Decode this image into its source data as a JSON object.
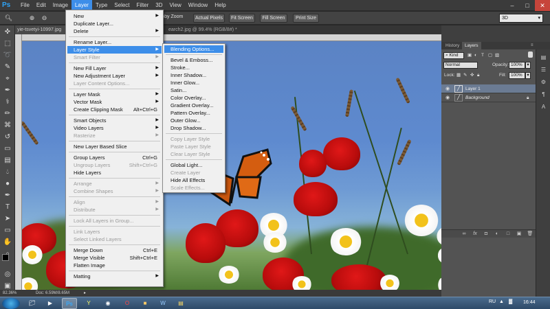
{
  "app": {
    "logo": "Ps",
    "menus": [
      "File",
      "Edit",
      "Image",
      "Layer",
      "Type",
      "Select",
      "Filter",
      "3D",
      "View",
      "Window",
      "Help"
    ],
    "active_menu": "Layer",
    "window_controls": [
      "–",
      "□",
      "✕"
    ]
  },
  "options_bar": {
    "scrubby_zoom": "rubby Zoom",
    "buttons": [
      "Actual Pixels",
      "Fit Screen",
      "Fill Screen",
      "Print Size"
    ],
    "workspace": "3D"
  },
  "document_tabs": [
    {
      "title": "yie-tsvetyi-10997.jpg",
      "active": true
    },
    {
      "title": "earch2.jpg @ 99.4% (RGB/8#) *",
      "active": false
    }
  ],
  "status": {
    "zoom": "82.36%",
    "doc_size": "Doc: 6.59M/8.65M"
  },
  "layer_menu": {
    "items": [
      {
        "label": "New",
        "shortcut": "",
        "submenu": true,
        "disabled": false
      },
      {
        "label": "Duplicate Layer...",
        "shortcut": "",
        "submenu": false,
        "disabled": false
      },
      {
        "label": "Delete",
        "shortcut": "",
        "submenu": true,
        "disabled": false
      },
      {
        "label": "Rename Layer...",
        "shortcut": "",
        "submenu": false,
        "disabled": false
      },
      {
        "label": "Layer Style",
        "shortcut": "",
        "submenu": true,
        "disabled": false,
        "highlight": true
      },
      {
        "label": "Smart Filter",
        "shortcut": "",
        "submenu": true,
        "disabled": true
      },
      {
        "label": "New Fill Layer",
        "shortcut": "",
        "submenu": true,
        "disabled": false
      },
      {
        "label": "New Adjustment Layer",
        "shortcut": "",
        "submenu": true,
        "disabled": false
      },
      {
        "label": "Layer Content Options...",
        "shortcut": "",
        "submenu": false,
        "disabled": true
      },
      {
        "label": "Layer Mask",
        "shortcut": "",
        "submenu": true,
        "disabled": false
      },
      {
        "label": "Vector Mask",
        "shortcut": "",
        "submenu": true,
        "disabled": false
      },
      {
        "label": "Create Clipping Mask",
        "shortcut": "Alt+Ctrl+G",
        "submenu": false,
        "disabled": false
      },
      {
        "label": "Smart Objects",
        "shortcut": "",
        "submenu": true,
        "disabled": false
      },
      {
        "label": "Video Layers",
        "shortcut": "",
        "submenu": true,
        "disabled": false
      },
      {
        "label": "Rasterize",
        "shortcut": "",
        "submenu": true,
        "disabled": true
      },
      {
        "label": "New Layer Based Slice",
        "shortcut": "",
        "submenu": false,
        "disabled": false
      },
      {
        "label": "Group Layers",
        "shortcut": "Ctrl+G",
        "submenu": false,
        "disabled": false
      },
      {
        "label": "Ungroup Layers",
        "shortcut": "Shift+Ctrl+G",
        "submenu": false,
        "disabled": true
      },
      {
        "label": "Hide Layers",
        "shortcut": "",
        "submenu": false,
        "disabled": false
      },
      {
        "label": "Arrange",
        "shortcut": "",
        "submenu": true,
        "disabled": true
      },
      {
        "label": "Combine Shapes",
        "shortcut": "",
        "submenu": true,
        "disabled": true
      },
      {
        "label": "Align",
        "shortcut": "",
        "submenu": true,
        "disabled": true
      },
      {
        "label": "Distribute",
        "shortcut": "",
        "submenu": true,
        "disabled": true
      },
      {
        "label": "Lock All Layers in Group...",
        "shortcut": "",
        "submenu": false,
        "disabled": true
      },
      {
        "label": "Link Layers",
        "shortcut": "",
        "submenu": false,
        "disabled": true
      },
      {
        "label": "Select Linked Layers",
        "shortcut": "",
        "submenu": false,
        "disabled": true
      },
      {
        "label": "Merge Down",
        "shortcut": "Ctrl+E",
        "submenu": false,
        "disabled": false
      },
      {
        "label": "Merge Visible",
        "shortcut": "Shift+Ctrl+E",
        "submenu": false,
        "disabled": false
      },
      {
        "label": "Flatten Image",
        "shortcut": "",
        "submenu": false,
        "disabled": false
      },
      {
        "label": "Matting",
        "shortcut": "",
        "submenu": true,
        "disabled": false
      }
    ]
  },
  "style_submenu": {
    "items": [
      {
        "label": "Blending Options...",
        "disabled": false,
        "highlight": true
      },
      {
        "label": "Bevel & Emboss...",
        "disabled": false
      },
      {
        "label": "Stroke...",
        "disabled": false
      },
      {
        "label": "Inner Shadow...",
        "disabled": false
      },
      {
        "label": "Inner Glow...",
        "disabled": false
      },
      {
        "label": "Satin...",
        "disabled": false
      },
      {
        "label": "Color Overlay...",
        "disabled": false
      },
      {
        "label": "Gradient Overlay...",
        "disabled": false
      },
      {
        "label": "Pattern Overlay...",
        "disabled": false
      },
      {
        "label": "Outer Glow...",
        "disabled": false
      },
      {
        "label": "Drop Shadow...",
        "disabled": false
      },
      {
        "label": "Copy Layer Style",
        "disabled": true
      },
      {
        "label": "Paste Layer Style",
        "disabled": true
      },
      {
        "label": "Clear Layer Style",
        "disabled": true
      },
      {
        "label": "Global Light...",
        "disabled": false
      },
      {
        "label": "Create Layer",
        "disabled": true
      },
      {
        "label": "Hide All Effects",
        "disabled": false
      },
      {
        "label": "Scale Effects...",
        "disabled": true
      }
    ]
  },
  "layers_panel": {
    "tabs": [
      "History",
      "Layers"
    ],
    "active_tab": "Layers",
    "kind_label": "Kind",
    "blend_mode": "Normal",
    "opacity_label": "Opacity:",
    "opacity_value": "100%",
    "lock_label": "Lock:",
    "fill_label": "Fill:",
    "fill_value": "100%",
    "layers": [
      {
        "name": "Layer 1",
        "selected": true,
        "italic": false
      },
      {
        "name": "Background",
        "selected": false,
        "italic": true
      }
    ]
  },
  "taskbar": {
    "lang": "RU",
    "clock": "16:44"
  },
  "colors": {
    "accent": "#3d8ee9",
    "menubar": "#3b3b3b",
    "panel": "#535353"
  }
}
